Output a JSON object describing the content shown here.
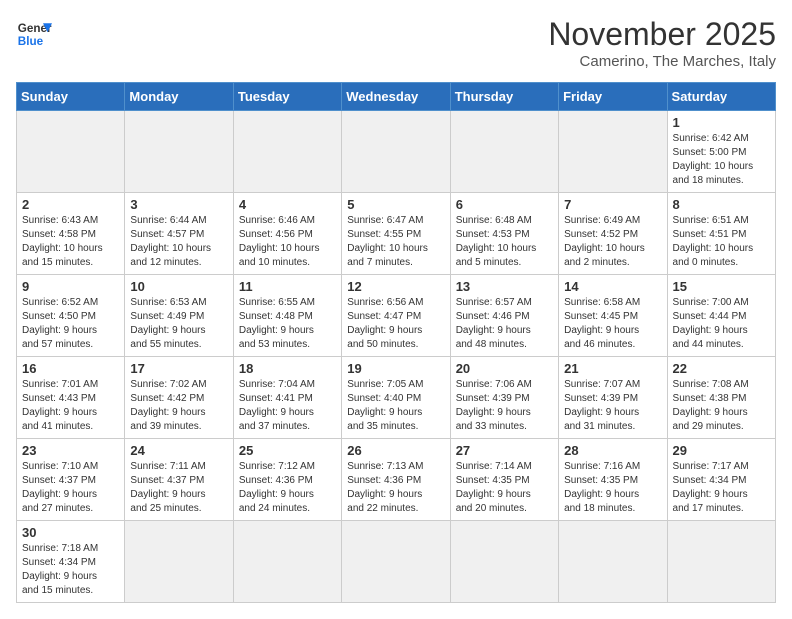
{
  "logo": {
    "line1": "General",
    "line2": "Blue"
  },
  "title": "November 2025",
  "subtitle": "Camerino, The Marches, Italy",
  "days_of_week": [
    "Sunday",
    "Monday",
    "Tuesday",
    "Wednesday",
    "Thursday",
    "Friday",
    "Saturday"
  ],
  "weeks": [
    [
      {
        "day": "",
        "info": ""
      },
      {
        "day": "",
        "info": ""
      },
      {
        "day": "",
        "info": ""
      },
      {
        "day": "",
        "info": ""
      },
      {
        "day": "",
        "info": ""
      },
      {
        "day": "",
        "info": ""
      },
      {
        "day": "1",
        "info": "Sunrise: 6:42 AM\nSunset: 5:00 PM\nDaylight: 10 hours\nand 18 minutes."
      }
    ],
    [
      {
        "day": "2",
        "info": "Sunrise: 6:43 AM\nSunset: 4:58 PM\nDaylight: 10 hours\nand 15 minutes."
      },
      {
        "day": "3",
        "info": "Sunrise: 6:44 AM\nSunset: 4:57 PM\nDaylight: 10 hours\nand 12 minutes."
      },
      {
        "day": "4",
        "info": "Sunrise: 6:46 AM\nSunset: 4:56 PM\nDaylight: 10 hours\nand 10 minutes."
      },
      {
        "day": "5",
        "info": "Sunrise: 6:47 AM\nSunset: 4:55 PM\nDaylight: 10 hours\nand 7 minutes."
      },
      {
        "day": "6",
        "info": "Sunrise: 6:48 AM\nSunset: 4:53 PM\nDaylight: 10 hours\nand 5 minutes."
      },
      {
        "day": "7",
        "info": "Sunrise: 6:49 AM\nSunset: 4:52 PM\nDaylight: 10 hours\nand 2 minutes."
      },
      {
        "day": "8",
        "info": "Sunrise: 6:51 AM\nSunset: 4:51 PM\nDaylight: 10 hours\nand 0 minutes."
      }
    ],
    [
      {
        "day": "9",
        "info": "Sunrise: 6:52 AM\nSunset: 4:50 PM\nDaylight: 9 hours\nand 57 minutes."
      },
      {
        "day": "10",
        "info": "Sunrise: 6:53 AM\nSunset: 4:49 PM\nDaylight: 9 hours\nand 55 minutes."
      },
      {
        "day": "11",
        "info": "Sunrise: 6:55 AM\nSunset: 4:48 PM\nDaylight: 9 hours\nand 53 minutes."
      },
      {
        "day": "12",
        "info": "Sunrise: 6:56 AM\nSunset: 4:47 PM\nDaylight: 9 hours\nand 50 minutes."
      },
      {
        "day": "13",
        "info": "Sunrise: 6:57 AM\nSunset: 4:46 PM\nDaylight: 9 hours\nand 48 minutes."
      },
      {
        "day": "14",
        "info": "Sunrise: 6:58 AM\nSunset: 4:45 PM\nDaylight: 9 hours\nand 46 minutes."
      },
      {
        "day": "15",
        "info": "Sunrise: 7:00 AM\nSunset: 4:44 PM\nDaylight: 9 hours\nand 44 minutes."
      }
    ],
    [
      {
        "day": "16",
        "info": "Sunrise: 7:01 AM\nSunset: 4:43 PM\nDaylight: 9 hours\nand 41 minutes."
      },
      {
        "day": "17",
        "info": "Sunrise: 7:02 AM\nSunset: 4:42 PM\nDaylight: 9 hours\nand 39 minutes."
      },
      {
        "day": "18",
        "info": "Sunrise: 7:04 AM\nSunset: 4:41 PM\nDaylight: 9 hours\nand 37 minutes."
      },
      {
        "day": "19",
        "info": "Sunrise: 7:05 AM\nSunset: 4:40 PM\nDaylight: 9 hours\nand 35 minutes."
      },
      {
        "day": "20",
        "info": "Sunrise: 7:06 AM\nSunset: 4:39 PM\nDaylight: 9 hours\nand 33 minutes."
      },
      {
        "day": "21",
        "info": "Sunrise: 7:07 AM\nSunset: 4:39 PM\nDaylight: 9 hours\nand 31 minutes."
      },
      {
        "day": "22",
        "info": "Sunrise: 7:08 AM\nSunset: 4:38 PM\nDaylight: 9 hours\nand 29 minutes."
      }
    ],
    [
      {
        "day": "23",
        "info": "Sunrise: 7:10 AM\nSunset: 4:37 PM\nDaylight: 9 hours\nand 27 minutes."
      },
      {
        "day": "24",
        "info": "Sunrise: 7:11 AM\nSunset: 4:37 PM\nDaylight: 9 hours\nand 25 minutes."
      },
      {
        "day": "25",
        "info": "Sunrise: 7:12 AM\nSunset: 4:36 PM\nDaylight: 9 hours\nand 24 minutes."
      },
      {
        "day": "26",
        "info": "Sunrise: 7:13 AM\nSunset: 4:36 PM\nDaylight: 9 hours\nand 22 minutes."
      },
      {
        "day": "27",
        "info": "Sunrise: 7:14 AM\nSunset: 4:35 PM\nDaylight: 9 hours\nand 20 minutes."
      },
      {
        "day": "28",
        "info": "Sunrise: 7:16 AM\nSunset: 4:35 PM\nDaylight: 9 hours\nand 18 minutes."
      },
      {
        "day": "29",
        "info": "Sunrise: 7:17 AM\nSunset: 4:34 PM\nDaylight: 9 hours\nand 17 minutes."
      }
    ],
    [
      {
        "day": "30",
        "info": "Sunrise: 7:18 AM\nSunset: 4:34 PM\nDaylight: 9 hours\nand 15 minutes."
      },
      {
        "day": "",
        "info": ""
      },
      {
        "day": "",
        "info": ""
      },
      {
        "day": "",
        "info": ""
      },
      {
        "day": "",
        "info": ""
      },
      {
        "day": "",
        "info": ""
      },
      {
        "day": "",
        "info": ""
      }
    ]
  ]
}
